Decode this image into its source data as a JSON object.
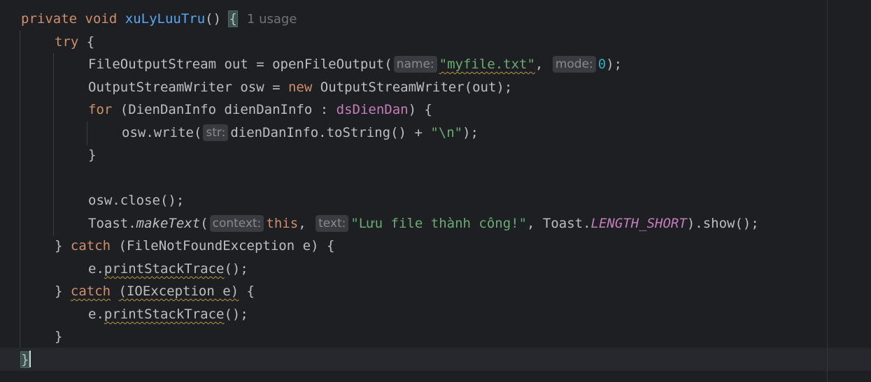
{
  "code": {
    "method_kw1": "private",
    "method_kw2": "void",
    "method_name": "xuLyLuuTru",
    "method_sig_rest": "() ",
    "open_brace": "{",
    "usage_hint": "1 usage",
    "try_kw": "try",
    "try_brace": " {",
    "l3_pre": "FileOutputStream out = openFileOutput(",
    "l3_hint_name": "name:",
    "l3_str": "\"myfile.txt\"",
    "l3_comma": ", ",
    "l3_hint_mode": "mode:",
    "l3_num": "0",
    "l3_end": ");",
    "l4_pre": "OutputStreamWriter osw = ",
    "l4_new": "new",
    "l4_rest": " OutputStreamWriter(out);",
    "l5_for": "for",
    "l5_mid": " (DienDanInfo dienDanInfo : ",
    "l5_field": "dsDienDan",
    "l5_end": ") {",
    "l6_pre": "osw.write(",
    "l6_hint": "str:",
    "l6_mid": "dienDanInfo.toString() + ",
    "l6_str": "\"\\n\"",
    "l6_end": ");",
    "l7": "}",
    "l9": "osw.close();",
    "l10_pre": "Toast.",
    "l10_method": "makeText",
    "l10_paren": "(",
    "l10_hint_context": "context:",
    "l10_this": "this",
    "l10_comma": ", ",
    "l10_hint_text": "text:",
    "l10_str": "\"Lưu file thành công!\"",
    "l10_mid": ", Toast.",
    "l10_const": "LENGTH_SHORT",
    "l10_end": ").show();",
    "l11_brace": "} ",
    "l11_catch": "catch",
    "l11_rest": " (FileNotFoundException e) {",
    "l12_pre": "e.",
    "l12_method": "printStackTrace",
    "l12_end": "();",
    "l13_brace": "} ",
    "l13_catch": "catch",
    "l13_paren": " ",
    "l13_sq": "(IOException e)",
    "l13_end": " {",
    "l14_pre": "e.",
    "l14_method": "printStackTrace",
    "l14_end": "();",
    "l15": "}",
    "l16": "}"
  },
  "colors": {
    "background": "#1e1f22",
    "keyword": "#cf8e6d",
    "function": "#56a8f5",
    "string": "#6aab73",
    "number": "#2aacb8",
    "field": "#c77dbb"
  }
}
